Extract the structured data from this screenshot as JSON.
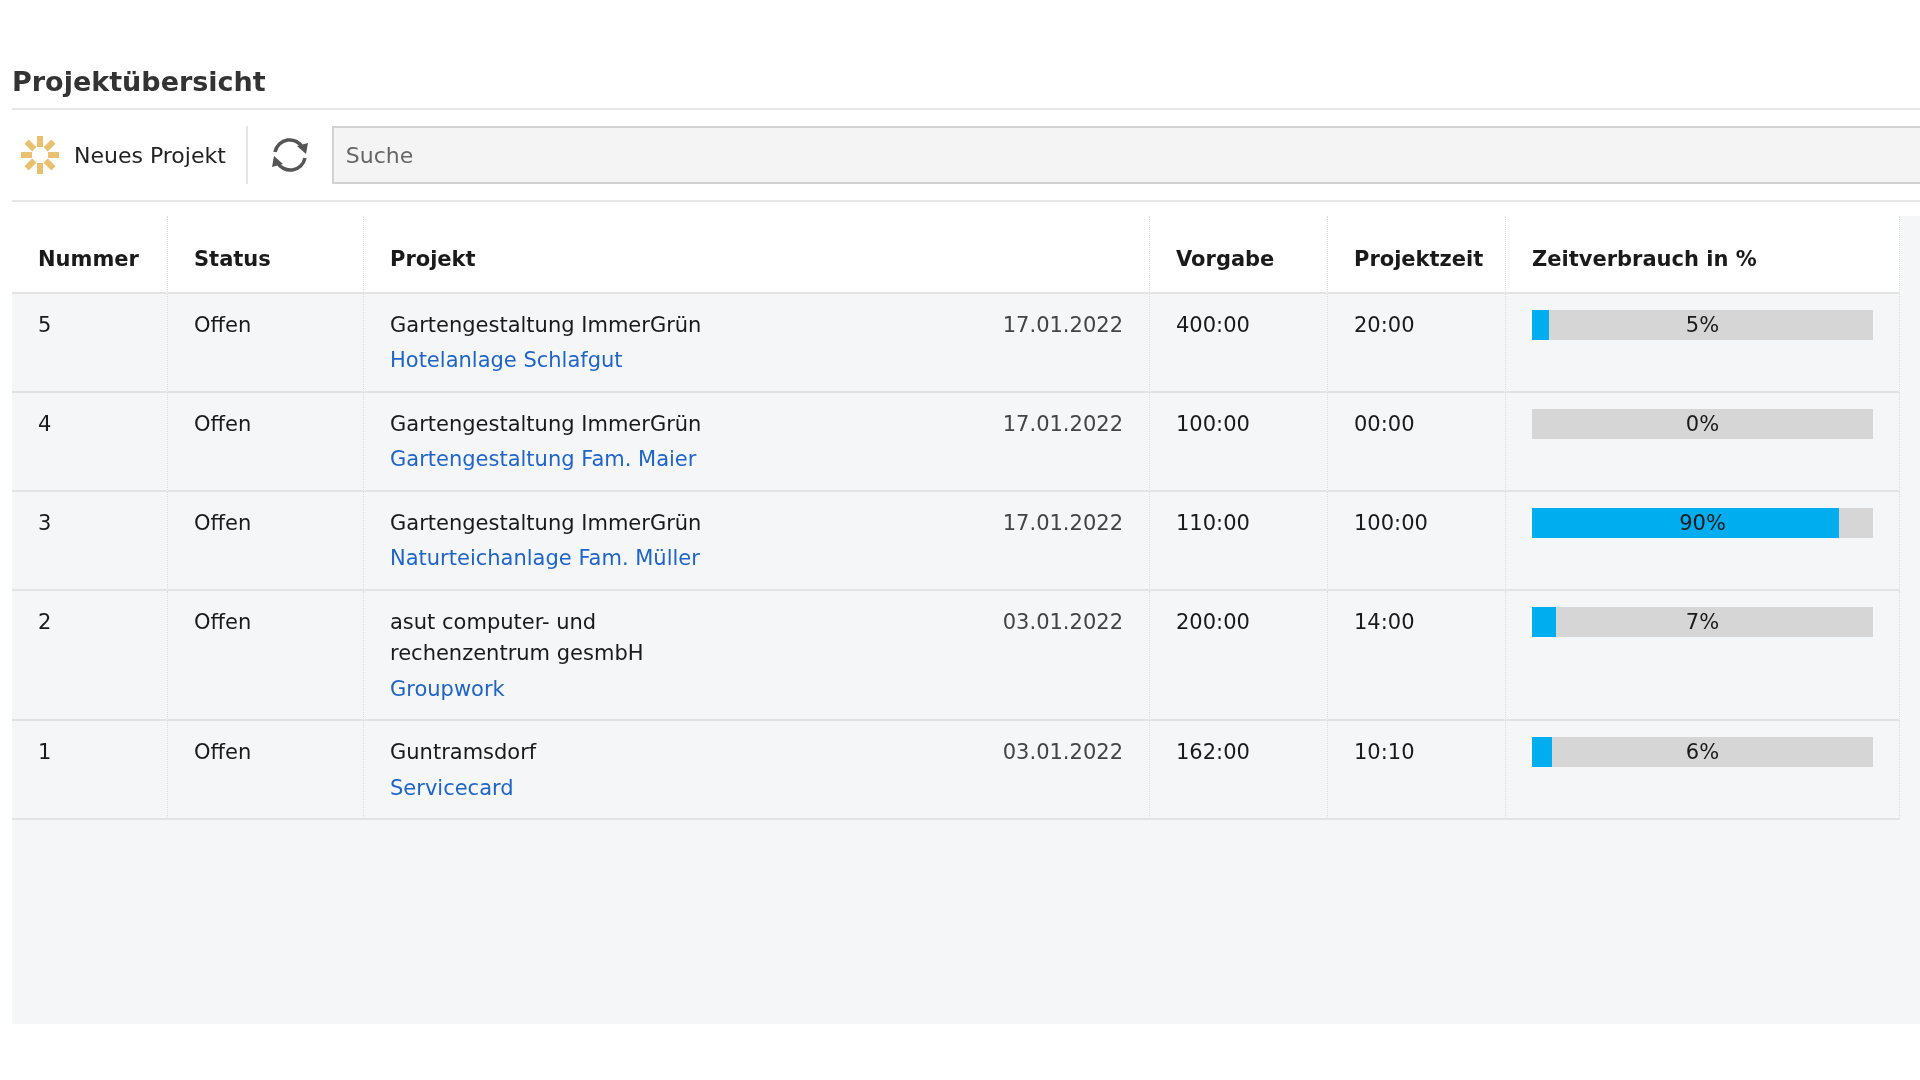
{
  "title": "Projektübersicht",
  "toolbar": {
    "new_button": "Neues Projekt",
    "search": {
      "placeholder": "Suche"
    }
  },
  "table": {
    "columns": [
      "Nummer",
      "Status",
      "Projekt",
      "Vorgabe",
      "Projektzeit",
      "Zeitverbrauch in %"
    ],
    "rows": [
      {
        "number": "5",
        "status": "Offen",
        "customer": "Gartengestaltung ImmerGrün",
        "project": "Hotelanlage Schlafgut",
        "date": "17.01.2022",
        "target": "400:00",
        "time": "20:00",
        "level": 0.05,
        "percent": "5%"
      },
      {
        "number": "4",
        "status": "Offen",
        "customer": "Gartengestaltung ImmerGrün",
        "project": "Gartengestaltung Fam. Maier",
        "date": "17.01.2022",
        "target": "100:00",
        "time": "00:00",
        "level": 0,
        "percent": "0%"
      },
      {
        "number": "3",
        "status": "Offen",
        "customer": "Gartengestaltung ImmerGrün",
        "project": "Naturteichanlage Fam. Müller",
        "date": "17.01.2022",
        "target": "110:00",
        "time": "100:00",
        "level": 0.9,
        "percent": "90%"
      },
      {
        "number": "2",
        "status": "Offen",
        "customer": "asut computer- und rechenzentrum gesmbH",
        "project": "Groupwork",
        "date": "03.01.2022",
        "target": "200:00",
        "time": "14:00",
        "level": 0.07,
        "percent": "7%"
      },
      {
        "number": "1",
        "status": "Offen",
        "customer": "Guntramsdorf",
        "project": "Servicecard",
        "date": "03.01.2022",
        "target": "162:00",
        "time": "10:10",
        "level": 0.06,
        "percent": "6%"
      }
    ]
  }
}
